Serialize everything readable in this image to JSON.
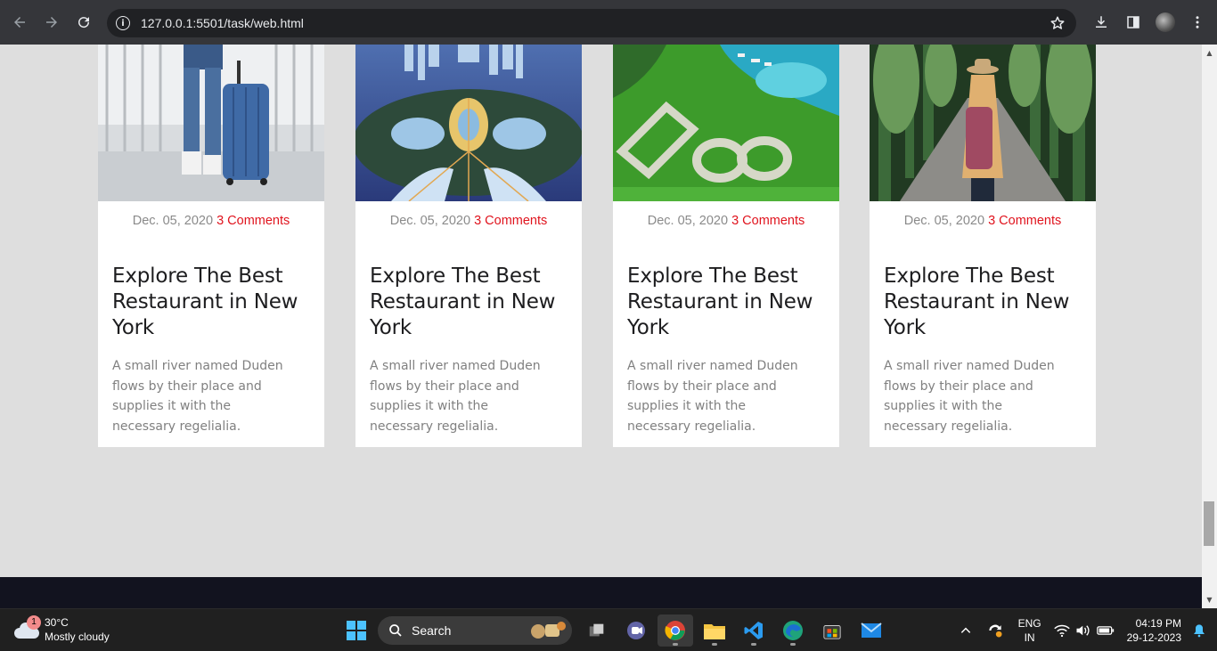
{
  "browser": {
    "url": "127.0.0.1:5501/task/web.html"
  },
  "cards": [
    {
      "date": "Dec. 05, 2020",
      "comments": "3 Comments",
      "title": "Explore The Best Restaurant in New York",
      "text": "A small river named Duden flows by their place and supplies it with the necessary regelialia."
    },
    {
      "date": "Dec. 05, 2020",
      "comments": "3 Comments",
      "title": "Explore The Best Restaurant in New York",
      "text": "A small river named Duden flows by their place and supplies it with the necessary regelialia."
    },
    {
      "date": "Dec. 05, 2020",
      "comments": "3 Comments",
      "title": "Explore The Best Restaurant in New York",
      "text": "A small river named Duden flows by their place and supplies it with the necessary regelialia."
    },
    {
      "date": "Dec. 05, 2020",
      "comments": "3 Comments",
      "title": "Explore The Best Restaurant in New York",
      "text": "A small river named Duden flows by their place and supplies it with the necessary regelialia."
    }
  ],
  "taskbar": {
    "weather": {
      "temp": "30°C",
      "condition": "Mostly cloudy",
      "badge": "1"
    },
    "search_label": "Search",
    "lang_top": "ENG",
    "lang_bottom": "IN",
    "time": "04:19 PM",
    "date": "29-12-2023"
  },
  "colors": {
    "accent": "#e0141e",
    "page_bg": "#dedede",
    "footer_bg": "#12131f"
  }
}
